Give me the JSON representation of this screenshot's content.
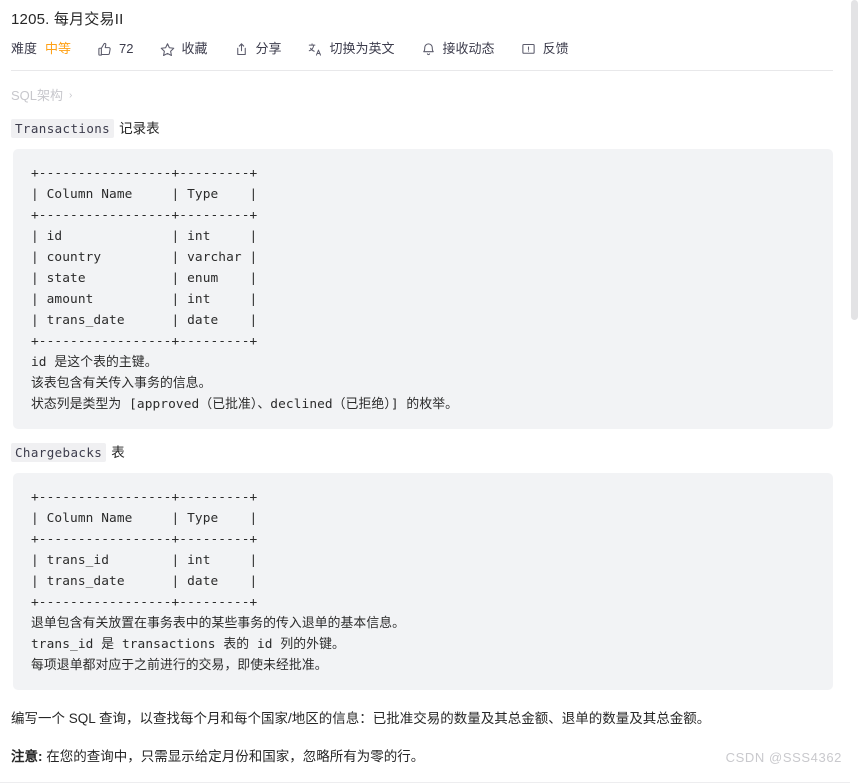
{
  "problem": {
    "title": "1205. 每月交易II"
  },
  "meta": {
    "difficulty_label": "难度",
    "difficulty_value": "中等",
    "likes_count": "72",
    "favorite_label": "收藏",
    "share_label": "分享",
    "translate_label": "切换为英文",
    "subscribe_label": "接收动态",
    "feedback_label": "反馈",
    "icons": {
      "like": "thumbs-up-icon",
      "favorite": "star-icon",
      "share": "share-icon",
      "translate": "translate-icon",
      "subscribe": "bell-icon",
      "feedback": "feedback-icon"
    }
  },
  "schema": {
    "toggle_label": "SQL架构",
    "chevron": "›"
  },
  "sections": [
    {
      "code_name": "Transactions",
      "suffix": "记录表",
      "block": "+-----------------+---------+\n| Column Name     | Type    |\n+-----------------+---------+\n| id              | int     |\n| country         | varchar |\n| state           | enum    |\n| amount          | int     |\n| trans_date      | date    |\n+-----------------+---------+\nid 是这个表的主键。\n该表包含有关传入事务的信息。\n状态列是类型为 [approved（已批准）、declined（已拒绝）] 的枚举。"
    },
    {
      "code_name": "Chargebacks",
      "suffix": "表",
      "block": "+-----------------+---------+\n| Column Name     | Type    |\n+-----------------+---------+\n| trans_id        | int     |\n| trans_date      | date    |\n+-----------------+---------+\n退单包含有关放置在事务表中的某些事务的传入退单的基本信息。\ntrans_id 是 transactions 表的 id 列的外键。\n每项退单都对应于之前进行的交易，即使未经批准。"
    }
  ],
  "prose": {
    "question": "编写一个 SQL 查询，以查找每个月和每个国家/地区的信息：已批准交易的数量及其总金额、退单的数量及其总金额。",
    "note_label": "注意:",
    "note_text": " 在您的查询中，只需显示给定月份和国家，忽略所有为零的行。"
  },
  "watermark": {
    "text": "CSDN @SSS4362"
  }
}
